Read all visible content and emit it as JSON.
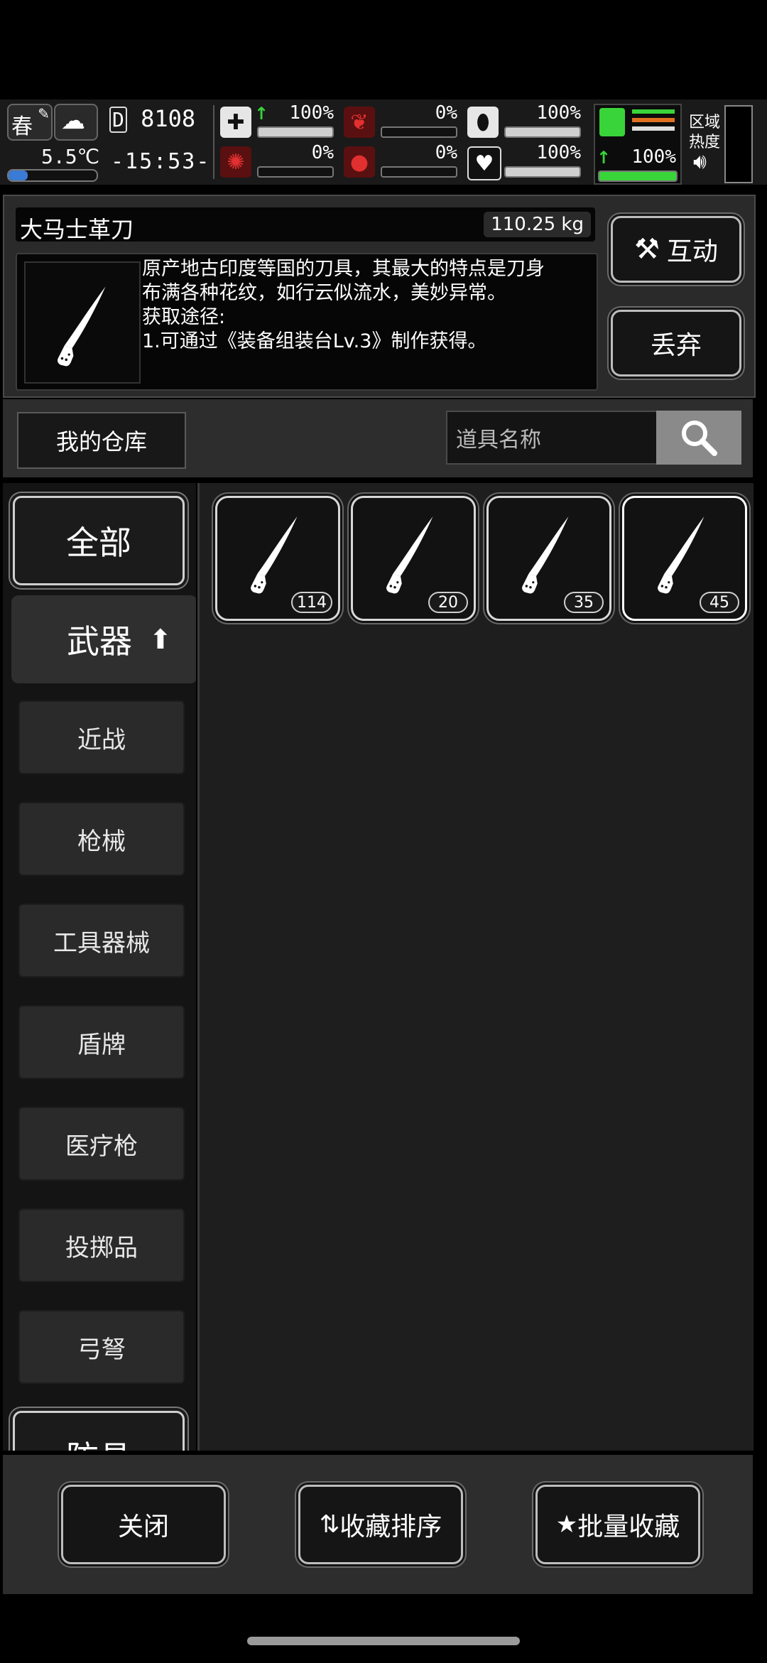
{
  "status": {
    "season": "春",
    "temperature": "5.5℃",
    "day_counter": "8108",
    "day_prefix": "D",
    "clock": "-15:53-",
    "stats": [
      {
        "icon": "medkit-icon",
        "value": "100%",
        "level": 1.0,
        "arrow": true
      },
      {
        "icon": "stomach-icon",
        "value": "0%",
        "level": 0.0,
        "arrow": false
      },
      {
        "icon": "mask-icon",
        "value": "100%",
        "level": 1.0,
        "arrow": false
      },
      {
        "icon": "brain-icon",
        "value": "0%",
        "level": 0.0,
        "arrow": false
      },
      {
        "icon": "blood-drop-icon",
        "value": "0%",
        "level": 0.0,
        "arrow": false
      },
      {
        "icon": "heart-icon",
        "value": "100%",
        "level": 1.0,
        "arrow": false
      }
    ],
    "stamina": {
      "value": "100%",
      "level": 1.0
    },
    "zone_label_1": "区域",
    "zone_label_2": "热度",
    "colors": {
      "green": "#39d439",
      "orange": "#e07020",
      "red": "#d83030"
    }
  },
  "item": {
    "name": "大马士革刀",
    "weight": "110.25 kg",
    "desc_line1": "原产地古印度等国的刀具，其最大的特点是刀身",
    "desc_line2": "布满各种花纹，如行云似流水，美妙异常。",
    "desc_line3": "获取途径:",
    "desc_line4": "1.可通过《装备组装台Lv.3》制作获得。",
    "interact_label": "互动",
    "discard_label": "丢弃"
  },
  "warehouse": {
    "title": "我的仓库",
    "search_placeholder": "道具名称"
  },
  "sidebar": {
    "all": "全部",
    "weapons": "武器",
    "subcategories": [
      "近战",
      "枪械",
      "工具器械",
      "盾牌",
      "医疗枪",
      "投掷品",
      "弓弩"
    ],
    "armor": "防具"
  },
  "grid": {
    "items": [
      {
        "icon": "knife-icon",
        "count": "114"
      },
      {
        "icon": "knife-icon",
        "count": "20"
      },
      {
        "icon": "knife-icon",
        "count": "35"
      },
      {
        "icon": "knife-icon",
        "count": "45",
        "selected": true
      }
    ]
  },
  "bottom": {
    "close": "关闭",
    "sort_favorites": "收藏排序",
    "batch_favorite": "批量收藏"
  }
}
